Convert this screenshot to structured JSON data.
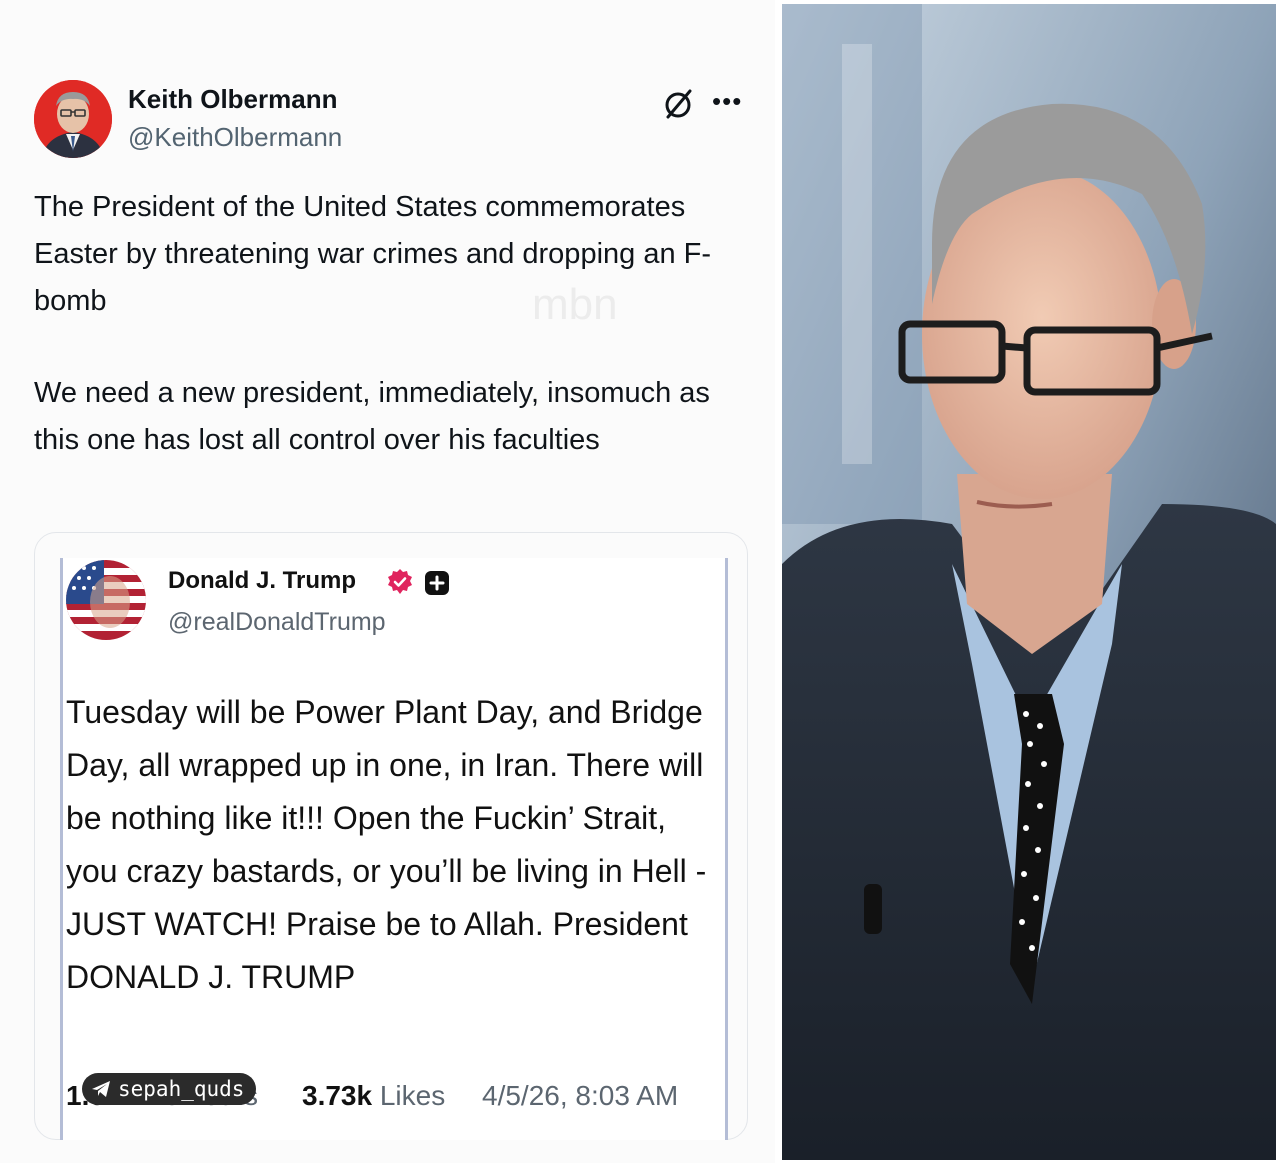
{
  "tweet": {
    "author_name": "Keith Olbermann",
    "author_handle": "@KeithOlbermann",
    "paragraph_1": "The President of the United States commemorates Easter by threatening war crimes and dropping an F-bomb",
    "paragraph_2": "We need a new president, immediately, insomuch as this one has lost all control over his faculties",
    "watermark": "mbn",
    "icons": [
      "grok-icon",
      "more-options-icon"
    ]
  },
  "quoted_post": {
    "author_name": "Donald J. Trump",
    "author_handle": "@realDonaldTrump",
    "text": "Tuesday will be Power Plant Day, and Bridge Day, all wrapped up in one, in Iran. There will be nothing like it!!! Open the Fuckin’ Strait, you crazy bastards, or you’ll be living in Hell - JUST WATCH! Praise be to Allah. President DONALD J. TRUMP",
    "retruths_count": "1.02k",
    "retruths_label": "ReTruths",
    "likes_count": "3.73k",
    "likes_label": "Likes",
    "timestamp": "4/5/26, 8:03 AM",
    "icons": [
      "verified-badge-icon",
      "plus-badge-icon"
    ],
    "verified_color": "#e0245e"
  },
  "overlay": {
    "telegram_badge": "sepah_quds"
  },
  "colors": {
    "avatar_red": "#e02a25",
    "quote_rule": "#b4bdd6",
    "handle_gray": "#536471"
  }
}
